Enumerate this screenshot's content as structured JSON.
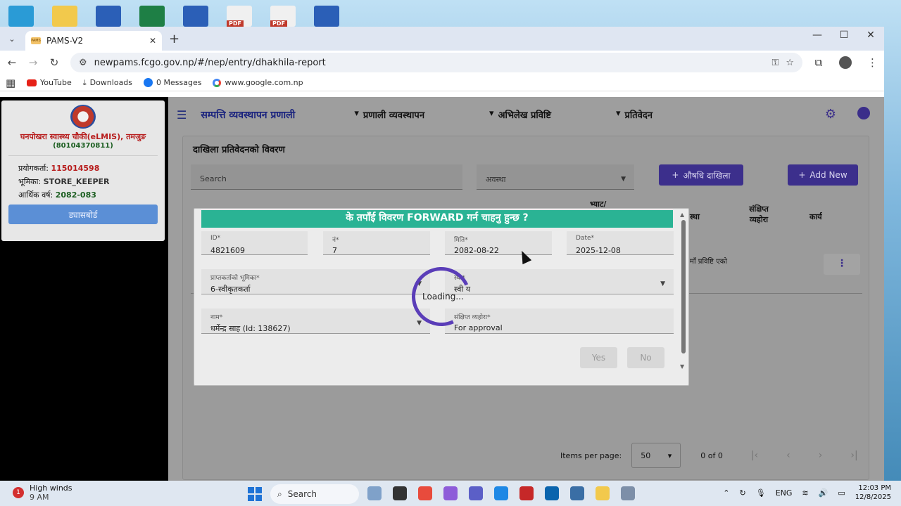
{
  "browser": {
    "tab_title": "PAMS-V2",
    "favicon_text": "PAMS",
    "url": "newpams.fcgo.gov.np/#/nep/entry/dhakhila-report",
    "bookmarks": [
      {
        "label": "YouTube"
      },
      {
        "label": "Downloads"
      },
      {
        "label": "0 Messages"
      },
      {
        "label": "www.google.com.np"
      }
    ]
  },
  "desktop": {
    "icon_pdf_label": "PDF"
  },
  "sidebar": {
    "org_name": "घनपोखरा स्वास्थ्य चौकी(eLMIS), तमजुङ",
    "org_code": "(80104370811)",
    "user_label": "प्रयोगकर्ता:",
    "user_value": "115014598",
    "role_label": "भूमिका:",
    "role_value": "STORE_KEEPER",
    "fy_label": "आर्थिक वर्ष:",
    "fy_value": "2082-083",
    "dashboard_label": "ड्यासबोर्ड"
  },
  "topbar": {
    "title": "सम्पत्ति व्यवस्थापन प्रणाली",
    "nav": [
      "प्रणाली व्यवस्थापन",
      "अभिलेख प्रविष्टि",
      "प्रतिवेदन"
    ]
  },
  "report": {
    "title": "दाखिला प्रतिवेदनको विवरण",
    "search_placeholder": "Search",
    "status_placeholder": "अवस्था",
    "aushadhi_btn": "औषधि दाखिला",
    "add_new_btn": "Add New",
    "headers": {
      "bhyat": "भ्याट/",
      "status": "स्था",
      "summary": "संक्षिप्त व्यहोरा",
      "action": "कार्य"
    },
    "row_status_text": "माँ प्रविष्टि एको",
    "items_per_page_label": "Items per page:",
    "page_size": "50",
    "range": "0 of 0"
  },
  "dialog": {
    "title": "के तपाँई विवरण FORWARD गर्न चाहनु हुन्छ ?",
    "fields": {
      "id": {
        "label": "ID",
        "value": "4821609"
      },
      "num": {
        "label": "नं",
        "value": "7"
      },
      "miti": {
        "label": "मिति",
        "value": "2082-08-22"
      },
      "date": {
        "label": "Date",
        "value": "2025-12-08"
      },
      "role": {
        "label": "प्राप्तकर्ताको भूमिका",
        "value": "6-स्वीकृतकर्ता"
      },
      "status": {
        "label": "स्था",
        "value": "स्वी य"
      },
      "name": {
        "label": "नाम",
        "value": "धर्मेन्द्र साह (Id: 138627)"
      },
      "remarks": {
        "label": "संक्षिप्त व्यहोरा",
        "value": "For approval"
      }
    },
    "yes_label": "Yes",
    "no_label": "No",
    "loading_text": "Loading..."
  },
  "taskbar": {
    "weather_title": "High winds",
    "weather_time": "9 AM",
    "weather_badge": "1",
    "search_label": "Search",
    "lang": "ENG",
    "time": "12:03 PM",
    "date": "12/8/2025"
  }
}
